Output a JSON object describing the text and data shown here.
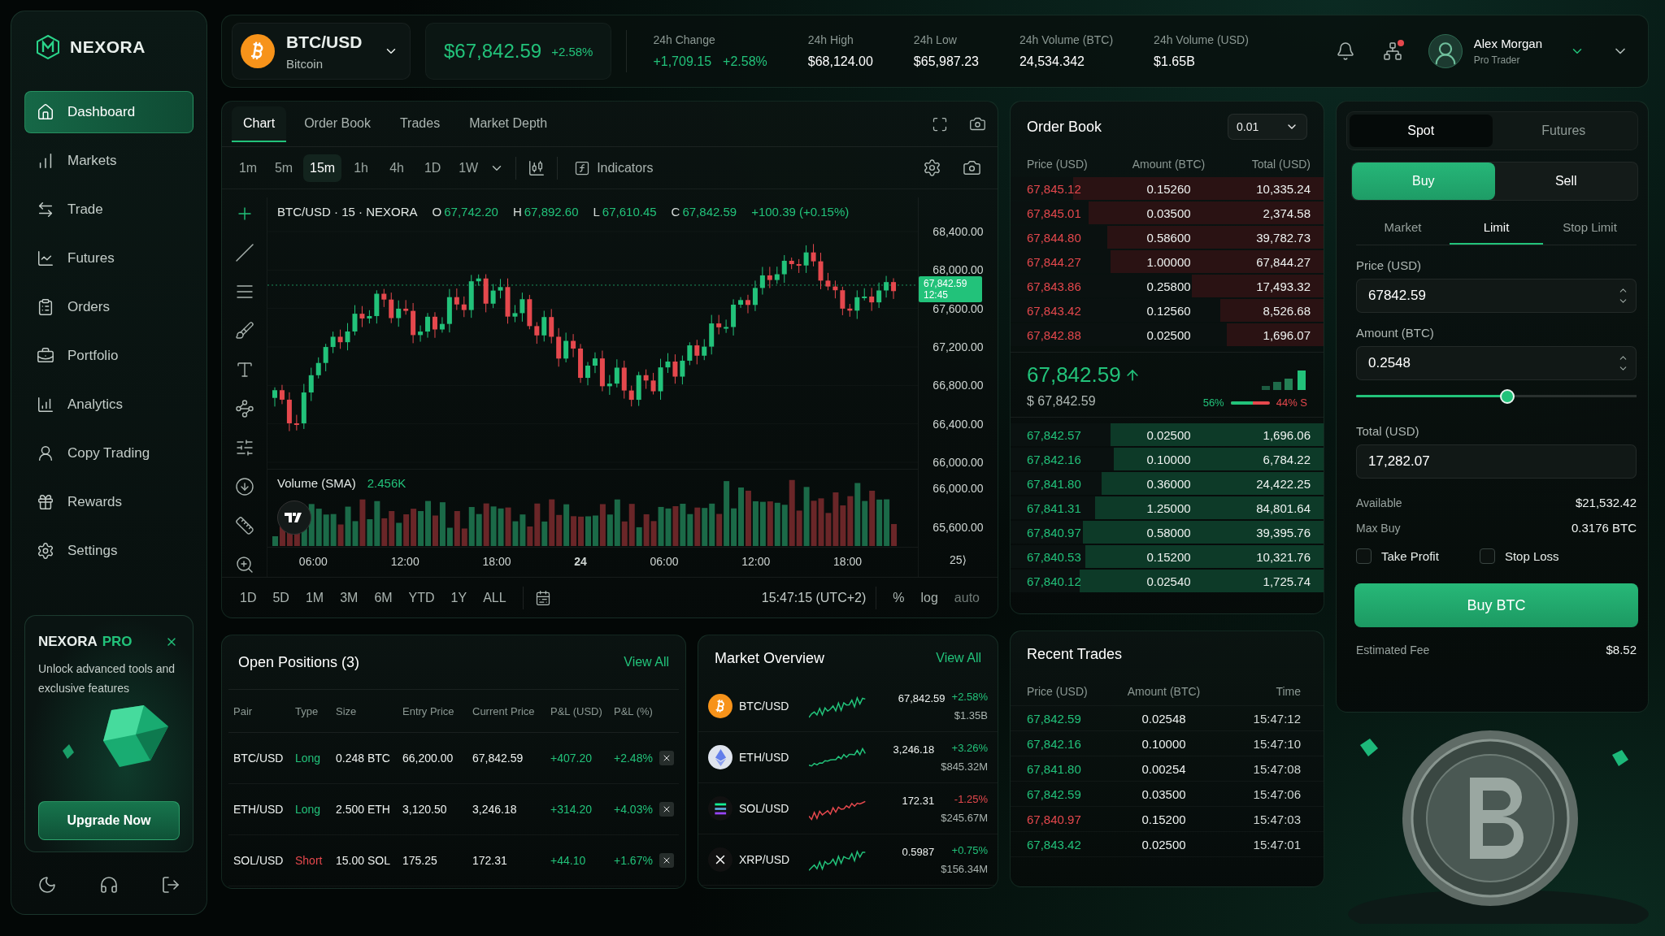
{
  "brand": {
    "name": "NEXORA"
  },
  "sidebar": {
    "items": [
      {
        "label": "Dashboard",
        "selected": true
      },
      {
        "label": "Markets",
        "selected": false
      },
      {
        "label": "Trade",
        "selected": false
      },
      {
        "label": "Futures",
        "selected": false
      },
      {
        "label": "Orders",
        "selected": false
      },
      {
        "label": "Portfolio",
        "selected": false
      },
      {
        "label": "Analytics",
        "selected": false
      },
      {
        "label": "Copy Trading",
        "selected": false
      },
      {
        "label": "Rewards",
        "selected": false
      },
      {
        "label": "Settings",
        "selected": false
      }
    ]
  },
  "promo": {
    "brand": "NEXORA",
    "tier": "PRO",
    "text": "Unlock advanced tools and exclusive features",
    "button": "Upgrade Now"
  },
  "header": {
    "pair": "BTC/USD",
    "name": "Bitcoin",
    "price": "$67,842.59",
    "change": "+2.58%",
    "stats": [
      {
        "label": "24h Change",
        "value": "+1,709.15",
        "extra": "+2.58%",
        "kind": "positive"
      },
      {
        "label": "24h High",
        "value": "$68,124.00",
        "kind": "plain"
      },
      {
        "label": "24h Low",
        "value": "$65,987.23",
        "kind": "plain"
      },
      {
        "label": "24h Volume (BTC)",
        "value": "24,534.342",
        "kind": "plain"
      },
      {
        "label": "24h Volume (USD)",
        "value": "$1.65B",
        "kind": "plain"
      }
    ],
    "notification_dot": true,
    "user": {
      "name": "Alex Morgan",
      "role": "Pro Trader"
    }
  },
  "chart": {
    "tabs": [
      {
        "label": "Chart",
        "selected": true
      },
      {
        "label": "Order Book",
        "selected": false
      },
      {
        "label": "Trades",
        "selected": false
      },
      {
        "label": "Market Depth",
        "selected": false
      }
    ],
    "timeframes": [
      {
        "label": "1m",
        "selected": false
      },
      {
        "label": "5m",
        "selected": false
      },
      {
        "label": "15m",
        "selected": true
      },
      {
        "label": "1h",
        "selected": false
      },
      {
        "label": "4h",
        "selected": false
      },
      {
        "label": "1D",
        "selected": false
      },
      {
        "label": "1W",
        "selected": false
      }
    ],
    "indicators": "Indicators",
    "legend": {
      "symbol": "BTC/USD · 15 · NEXORA",
      "ohlc": [
        {
          "label": "O",
          "value": "67,742.20"
        },
        {
          "label": "H",
          "value": "67,892.60"
        },
        {
          "label": "L",
          "value": "67,610.45"
        },
        {
          "label": "C",
          "value": "67,842.59"
        }
      ],
      "change": "+100.39 (+0.15%)"
    },
    "price_axis": [
      "68,400.00",
      "68,000.00",
      "67,600.00",
      "67,200.00",
      "66,800.00",
      "66,400.00",
      "66,000.00"
    ],
    "current_price": {
      "price": "67,842.59",
      "countdown": "12:45"
    },
    "volume": {
      "label": "Volume (SMA)",
      "value": "2.456K",
      "axis": [
        "66,000.00",
        "65,600.00"
      ]
    },
    "time_axis": [
      "06:00",
      "12:00",
      "18:00",
      "24",
      "06:00",
      "12:00",
      "18:00"
    ],
    "time_axis_end": "25⟩",
    "ranges": [
      "1D",
      "5D",
      "1M",
      "3M",
      "6M",
      "YTD",
      "1Y",
      "ALL"
    ],
    "clock": "15:47:15 (UTC+2)",
    "scale_options": [
      "%",
      "log",
      "auto"
    ]
  },
  "order_book": {
    "title": "Order Book",
    "precision": "0.01",
    "columns": [
      "Price (USD)",
      "Amount (BTC)",
      "Total (USD)"
    ],
    "asks": [
      {
        "price": "67,845.12",
        "amount": "0.15260",
        "total": "10,335.24",
        "level": 0.8
      },
      {
        "price": "67,845.01",
        "amount": "0.03500",
        "total": "2,374.58",
        "level": 0.75
      },
      {
        "price": "67,844.80",
        "amount": "0.58600",
        "total": "39,782.73",
        "level": 0.69
      },
      {
        "price": "67,844.27",
        "amount": "1.00000",
        "total": "67,844.27",
        "level": 0.68
      },
      {
        "price": "67,843.86",
        "amount": "0.25800",
        "total": "17,493.32",
        "level": 0.42
      },
      {
        "price": "67,843.42",
        "amount": "0.12560",
        "total": "8,526.68",
        "level": 0.33
      },
      {
        "price": "67,842.88",
        "amount": "0.02500",
        "total": "1,696.07",
        "level": 0.31
      }
    ],
    "mid": {
      "price": "67,842.59",
      "usd": "$ 67,842.59"
    },
    "ratio": {
      "buy": "56%",
      "sell": "44% S",
      "level": 0.56
    },
    "bids": [
      {
        "price": "67,842.57",
        "amount": "0.02500",
        "total": "1,696.06",
        "level": 0.68
      },
      {
        "price": "67,842.16",
        "amount": "0.10000",
        "total": "6,784.22",
        "level": 0.67
      },
      {
        "price": "67,841.80",
        "amount": "0.36000",
        "total": "24,422.25",
        "level": 0.71
      },
      {
        "price": "67,841.31",
        "amount": "1.25000",
        "total": "84,801.64",
        "level": 0.73
      },
      {
        "price": "67,840.97",
        "amount": "0.58000",
        "total": "39,395.76",
        "level": 0.77
      },
      {
        "price": "67,840.53",
        "amount": "0.15200",
        "total": "10,321.76",
        "level": 0.76
      },
      {
        "price": "67,840.12",
        "amount": "0.02540",
        "total": "1,725.74",
        "level": 0.78
      }
    ]
  },
  "trade": {
    "markets": [
      {
        "label": "Spot",
        "selected": true
      },
      {
        "label": "Futures",
        "selected": false
      }
    ],
    "sides": [
      {
        "label": "Buy",
        "selected": true
      },
      {
        "label": "Sell",
        "selected": false
      }
    ],
    "order_types": [
      {
        "label": "Market",
        "selected": false
      },
      {
        "label": "Limit",
        "selected": true
      },
      {
        "label": "Stop Limit",
        "selected": false
      }
    ],
    "price": {
      "label": "Price (USD)",
      "value": "67842.59"
    },
    "amount": {
      "label": "Amount (BTC)",
      "value": "0.2548"
    },
    "slider": {
      "level": 0.54
    },
    "total": {
      "label": "Total (USD)",
      "value": "17,282.07"
    },
    "summary": [
      {
        "label": "Available",
        "value": "$21,532.42"
      },
      {
        "label": "Max Buy",
        "value": "0.3176 BTC"
      }
    ],
    "options": [
      {
        "label": "Take Profit",
        "checked": false
      },
      {
        "label": "Stop Loss",
        "checked": false
      }
    ],
    "submit": "Buy BTC",
    "fee": {
      "label": "Estimated Fee",
      "value": "$8.52"
    }
  },
  "positions": {
    "title": "Open Positions (3)",
    "view_all": "View All",
    "columns": [
      "Pair",
      "Type",
      "Size",
      "Entry Price",
      "Current Price",
      "P&L (USD)",
      "P&L (%)"
    ],
    "rows": [
      {
        "pair": "BTC/USD",
        "type": "Long",
        "color": "#22c27a",
        "size": "0.248 BTC",
        "entry": "66,200.00",
        "current": "67,842.59",
        "pnl": "+407.20",
        "pnl_pct": "+2.48%"
      },
      {
        "pair": "ETH/USD",
        "type": "Long",
        "color": "#22c27a",
        "size": "2.500 ETH",
        "entry": "3,120.50",
        "current": "3,246.18",
        "pnl": "+314.20",
        "pnl_pct": "+4.03%"
      },
      {
        "pair": "SOL/USD",
        "type": "Short",
        "color": "#e5484d",
        "size": "15.00 SOL",
        "entry": "175.25",
        "current": "172.31",
        "pnl": "+44.10",
        "pnl_pct": "+1.67%"
      }
    ]
  },
  "market": {
    "title": "Market Overview",
    "view_all": "View All",
    "items": [
      {
        "pair": "BTC/USD",
        "price": "67,842.59",
        "change": "+2.58%",
        "volume": "$1.35B",
        "color": "#22c27a"
      },
      {
        "pair": "ETH/USD",
        "price": "3,246.18",
        "change": "+3.26%",
        "volume": "$845.32M",
        "color": "#22c27a"
      },
      {
        "pair": "SOL/USD",
        "price": "172.31",
        "change": "-1.25%",
        "volume": "$245.67M",
        "color": "#e5484d"
      },
      {
        "pair": "XRP/USD",
        "price": "0.5987",
        "change": "+0.75%",
        "volume": "$156.34M",
        "color": "#22c27a"
      }
    ]
  },
  "trades": {
    "title": "Recent Trades",
    "columns": [
      "Price (USD)",
      "Amount (BTC)",
      "Time"
    ],
    "rows": [
      {
        "price": "67,842.59",
        "amount": "0.02548",
        "time": "15:47:12",
        "color": "#22c27a"
      },
      {
        "price": "67,842.16",
        "amount": "0.10000",
        "time": "15:47:10",
        "color": "#22c27a"
      },
      {
        "price": "67,841.80",
        "amount": "0.00254",
        "time": "15:47:08",
        "color": "#22c27a"
      },
      {
        "price": "67,842.59",
        "amount": "0.03500",
        "time": "15:47:06",
        "color": "#22c27a"
      },
      {
        "price": "67,840.97",
        "amount": "0.15200",
        "time": "15:47:03",
        "color": "#e5484d"
      },
      {
        "price": "67,843.42",
        "amount": "0.02500",
        "time": "15:47:01",
        "color": "#22c27a"
      }
    ]
  }
}
